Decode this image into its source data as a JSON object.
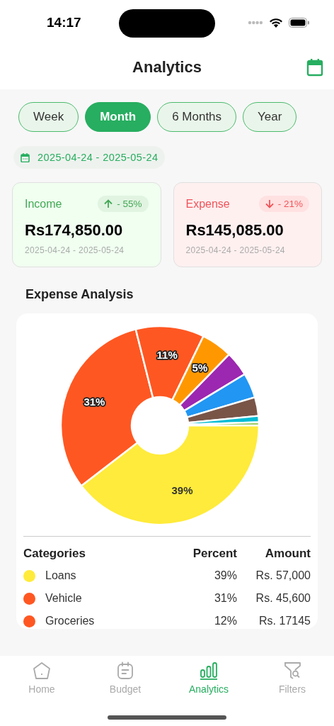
{
  "status_bar": {
    "time": "14:17"
  },
  "header": {
    "title": "Analytics"
  },
  "periods": [
    {
      "label": "Week",
      "selected": false
    },
    {
      "label": "Month",
      "selected": true
    },
    {
      "label": "6 Months",
      "selected": false
    },
    {
      "label": "Year",
      "selected": false
    }
  ],
  "date_range": "2025-04-24 - 2025-05-24",
  "summary_cards": [
    {
      "kind": "income",
      "label": "Income",
      "change": "- 55%",
      "amount": "Rs174,850.00",
      "range": "2025-04-24 - 2025-05-24"
    },
    {
      "kind": "expense",
      "label": "Expense",
      "change": "- 21%",
      "amount": "Rs145,085.00",
      "range": "2025-04-24 - 2025-05-24"
    }
  ],
  "expense_analysis": {
    "title": "Expense Analysis",
    "chart_data": {
      "type": "donut",
      "values": [
        39,
        31,
        11,
        5,
        4,
        4,
        3,
        1,
        0.5
      ],
      "colors": [
        "#ffeb3b",
        "#ff5722",
        "#ff5722",
        "#ff9800",
        "#9c27b0",
        "#2196f3",
        "#795548",
        "#00bcd4",
        "#8bc34a"
      ],
      "value_labels": [
        "39%",
        "31%",
        "11%",
        "5%",
        null,
        null,
        null,
        null,
        null
      ]
    },
    "table": {
      "columns": [
        "Categories",
        "Percent",
        "Amount"
      ],
      "rows": [
        {
          "name": "Loans",
          "percent": "39%",
          "amount": "Rs. 57,000",
          "color": "#ffeb3b"
        },
        {
          "name": "Vehicle",
          "percent": "31%",
          "amount": "Rs. 45,600",
          "color": "#ff5722"
        },
        {
          "name": "Groceries",
          "percent": "12%",
          "amount": "Rs. 17145",
          "color": "#ff5722"
        }
      ]
    }
  },
  "tab_bar": [
    {
      "label": "Home",
      "selected": false
    },
    {
      "label": "Budget",
      "selected": false
    },
    {
      "label": "Analytics",
      "selected": true
    },
    {
      "label": "Filters",
      "selected": false
    }
  ]
}
